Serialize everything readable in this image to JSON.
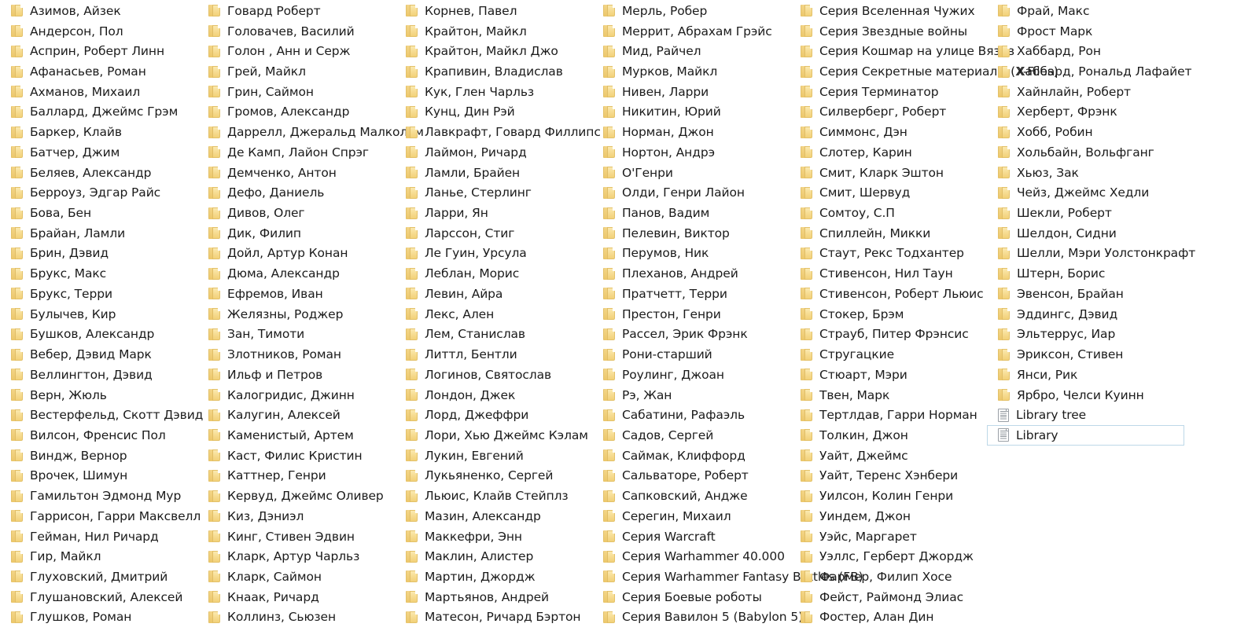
{
  "view": {
    "type": "file-explorer-list",
    "columns": 6,
    "rows_per_column": 31,
    "background_color": "#ffffff",
    "text_color": "#1b1b1b",
    "folder_icon_color": "#f4d57f",
    "document_icon_color": "#9aa0a6",
    "selection_border_color": "#bdd8e8"
  },
  "items": [
    {
      "label": "Азимов, Айзек",
      "icon": "folder-icon",
      "selected": false
    },
    {
      "label": "Андерсон, Пол",
      "icon": "folder-icon",
      "selected": false
    },
    {
      "label": "Асприн, Роберт Линн",
      "icon": "folder-icon",
      "selected": false
    },
    {
      "label": "Афанасьев, Роман",
      "icon": "folder-icon",
      "selected": false
    },
    {
      "label": "Ахманов, Михаил",
      "icon": "folder-icon",
      "selected": false
    },
    {
      "label": "Баллард, Джеймс Грэм",
      "icon": "folder-icon",
      "selected": false
    },
    {
      "label": "Баркер, Клайв",
      "icon": "folder-icon",
      "selected": false
    },
    {
      "label": "Батчер, Джим",
      "icon": "folder-icon",
      "selected": false
    },
    {
      "label": "Беляев, Александр",
      "icon": "folder-icon",
      "selected": false
    },
    {
      "label": "Берроуз, Эдгар Райс",
      "icon": "folder-icon",
      "selected": false
    },
    {
      "label": "Бова, Бен",
      "icon": "folder-icon",
      "selected": false
    },
    {
      "label": "Брайан, Ламли",
      "icon": "folder-icon",
      "selected": false
    },
    {
      "label": "Брин, Дэвид",
      "icon": "folder-icon",
      "selected": false
    },
    {
      "label": "Брукс, Макс",
      "icon": "folder-icon",
      "selected": false
    },
    {
      "label": "Брукс, Терри",
      "icon": "folder-icon",
      "selected": false
    },
    {
      "label": "Булычев, Кир",
      "icon": "folder-icon",
      "selected": false
    },
    {
      "label": "Бушков, Александр",
      "icon": "folder-icon",
      "selected": false
    },
    {
      "label": "Вебер, Дэвид Марк",
      "icon": "folder-icon",
      "selected": false
    },
    {
      "label": "Веллингтон, Дэвид",
      "icon": "folder-icon",
      "selected": false
    },
    {
      "label": "Верн, Жюль",
      "icon": "folder-icon",
      "selected": false
    },
    {
      "label": "Вестерфельд, Скотт Дэвид",
      "icon": "folder-icon",
      "selected": false
    },
    {
      "label": "Вилсон, Френсис Пол",
      "icon": "folder-icon",
      "selected": false
    },
    {
      "label": "Виндж, Вернор",
      "icon": "folder-icon",
      "selected": false
    },
    {
      "label": "Врочек, Шимун",
      "icon": "folder-icon",
      "selected": false
    },
    {
      "label": "Гамильтон Эдмонд Мур",
      "icon": "folder-icon",
      "selected": false
    },
    {
      "label": "Гаррисон, Гарри Максвелл",
      "icon": "folder-icon",
      "selected": false
    },
    {
      "label": "Гейман, Нил Ричард",
      "icon": "folder-icon",
      "selected": false
    },
    {
      "label": "Гир, Майкл",
      "icon": "folder-icon",
      "selected": false
    },
    {
      "label": "Глуховский, Дмитрий",
      "icon": "folder-icon",
      "selected": false
    },
    {
      "label": "Глушановский, Алексей",
      "icon": "folder-icon",
      "selected": false
    },
    {
      "label": "Глушков, Роман",
      "icon": "folder-icon",
      "selected": false
    },
    {
      "label": "Говард Роберт",
      "icon": "folder-icon",
      "selected": false
    },
    {
      "label": "Головачев, Василий",
      "icon": "folder-icon",
      "selected": false
    },
    {
      "label": "Голон , Анн и Серж",
      "icon": "folder-icon",
      "selected": false
    },
    {
      "label": "Грей, Майкл",
      "icon": "folder-icon",
      "selected": false
    },
    {
      "label": "Грин, Саймон",
      "icon": "folder-icon",
      "selected": false
    },
    {
      "label": "Громов, Александр",
      "icon": "folder-icon",
      "selected": false
    },
    {
      "label": "Даррелл, Джеральд Малкольм",
      "icon": "folder-icon",
      "selected": false
    },
    {
      "label": "Де Камп, Лайон Спрэг",
      "icon": "folder-icon",
      "selected": false
    },
    {
      "label": "Демченко, Антон",
      "icon": "folder-icon",
      "selected": false
    },
    {
      "label": "Дефо, Даниель",
      "icon": "folder-icon",
      "selected": false
    },
    {
      "label": "Дивов, Олег",
      "icon": "folder-icon",
      "selected": false
    },
    {
      "label": "Дик, Филип",
      "icon": "folder-icon",
      "selected": false
    },
    {
      "label": "Дойл, Артур Конан",
      "icon": "folder-icon",
      "selected": false
    },
    {
      "label": "Дюма, Александр",
      "icon": "folder-icon",
      "selected": false
    },
    {
      "label": "Ефремов, Иван",
      "icon": "folder-icon",
      "selected": false
    },
    {
      "label": "Желязны, Роджер",
      "icon": "folder-icon",
      "selected": false
    },
    {
      "label": "Зан, Тимоти",
      "icon": "folder-icon",
      "selected": false
    },
    {
      "label": "Злотников, Роман",
      "icon": "folder-icon",
      "selected": false
    },
    {
      "label": "Ильф и  Петров",
      "icon": "folder-icon",
      "selected": false
    },
    {
      "label": "Калогридис, Джинн",
      "icon": "folder-icon",
      "selected": false
    },
    {
      "label": "Калугин, Алексей",
      "icon": "folder-icon",
      "selected": false
    },
    {
      "label": "Каменистый, Артем",
      "icon": "folder-icon",
      "selected": false
    },
    {
      "label": "Каст, Филис Кристин",
      "icon": "folder-icon",
      "selected": false
    },
    {
      "label": "Каттнер, Генри",
      "icon": "folder-icon",
      "selected": false
    },
    {
      "label": "Кервуд, Джеймс Оливер",
      "icon": "folder-icon",
      "selected": false
    },
    {
      "label": "Киз, Дэниэл",
      "icon": "folder-icon",
      "selected": false
    },
    {
      "label": "Кинг, Стивен Эдвин",
      "icon": "folder-icon",
      "selected": false
    },
    {
      "label": "Кларк, Артур Чарльз",
      "icon": "folder-icon",
      "selected": false
    },
    {
      "label": "Кларк, Саймон",
      "icon": "folder-icon",
      "selected": false
    },
    {
      "label": "Кнаак, Ричард",
      "icon": "folder-icon",
      "selected": false
    },
    {
      "label": "Коллинз, Сьюзен",
      "icon": "folder-icon",
      "selected": false
    },
    {
      "label": "Корнев, Павел",
      "icon": "folder-icon",
      "selected": false
    },
    {
      "label": "Крайтон, Майкл",
      "icon": "folder-icon",
      "selected": false
    },
    {
      "label": "Крайтон, Майкл Джо",
      "icon": "folder-icon",
      "selected": false
    },
    {
      "label": "Крапивин, Владислав",
      "icon": "folder-icon",
      "selected": false
    },
    {
      "label": "Кук, Глен Чарльз",
      "icon": "folder-icon",
      "selected": false
    },
    {
      "label": "Кунц, Дин Рэй",
      "icon": "folder-icon",
      "selected": false
    },
    {
      "label": "Лавкрафт, Говард Филлипс",
      "icon": "folder-icon",
      "selected": false
    },
    {
      "label": "Лаймон, Ричард",
      "icon": "folder-icon",
      "selected": false
    },
    {
      "label": "Ламли, Брайен",
      "icon": "folder-icon",
      "selected": false
    },
    {
      "label": "Ланье, Стерлинг",
      "icon": "folder-icon",
      "selected": false
    },
    {
      "label": "Ларри, Ян",
      "icon": "folder-icon",
      "selected": false
    },
    {
      "label": "Ларссон, Стиг",
      "icon": "folder-icon",
      "selected": false
    },
    {
      "label": "Ле Гуин, Урсула",
      "icon": "folder-icon",
      "selected": false
    },
    {
      "label": "Леблан, Морис",
      "icon": "folder-icon",
      "selected": false
    },
    {
      "label": "Левин, Айра",
      "icon": "folder-icon",
      "selected": false
    },
    {
      "label": "Лекс, Ален",
      "icon": "folder-icon",
      "selected": false
    },
    {
      "label": "Лем, Станислав",
      "icon": "folder-icon",
      "selected": false
    },
    {
      "label": "Литтл, Бентли",
      "icon": "folder-icon",
      "selected": false
    },
    {
      "label": "Логинов, Святослав",
      "icon": "folder-icon",
      "selected": false
    },
    {
      "label": "Лондон, Джек",
      "icon": "folder-icon",
      "selected": false
    },
    {
      "label": "Лорд, Джеффри",
      "icon": "folder-icon",
      "selected": false
    },
    {
      "label": "Лори, Хью Джеймс Кэлам",
      "icon": "folder-icon",
      "selected": false
    },
    {
      "label": "Лукин, Евгений",
      "icon": "folder-icon",
      "selected": false
    },
    {
      "label": "Лукьяненко, Сергей",
      "icon": "folder-icon",
      "selected": false
    },
    {
      "label": "Льюис, Клайв Стейплз",
      "icon": "folder-icon",
      "selected": false
    },
    {
      "label": "Мазин, Александр",
      "icon": "folder-icon",
      "selected": false
    },
    {
      "label": "Маккефри, Энн",
      "icon": "folder-icon",
      "selected": false
    },
    {
      "label": "Маклин, Алистер",
      "icon": "folder-icon",
      "selected": false
    },
    {
      "label": "Мартин, Джордж",
      "icon": "folder-icon",
      "selected": false
    },
    {
      "label": "Мартьянов, Андрей",
      "icon": "folder-icon",
      "selected": false
    },
    {
      "label": "Матесон, Ричард Бэртон",
      "icon": "folder-icon",
      "selected": false
    },
    {
      "label": "Мерль, Робер",
      "icon": "folder-icon",
      "selected": false
    },
    {
      "label": "Меррит, Абрахам Грэйс",
      "icon": "folder-icon",
      "selected": false
    },
    {
      "label": "Мид, Райчел",
      "icon": "folder-icon",
      "selected": false
    },
    {
      "label": "Мурков, Майкл",
      "icon": "folder-icon",
      "selected": false
    },
    {
      "label": "Нивен, Ларри",
      "icon": "folder-icon",
      "selected": false
    },
    {
      "label": "Никитин, Юрий",
      "icon": "folder-icon",
      "selected": false
    },
    {
      "label": "Норман, Джон",
      "icon": "folder-icon",
      "selected": false
    },
    {
      "label": "Нортон, Андрэ",
      "icon": "folder-icon",
      "selected": false
    },
    {
      "label": "О'Генри",
      "icon": "folder-icon",
      "selected": false
    },
    {
      "label": "Олди, Генри Лайон",
      "icon": "folder-icon",
      "selected": false
    },
    {
      "label": "Панов, Вадим",
      "icon": "folder-icon",
      "selected": false
    },
    {
      "label": "Пелевин, Виктор",
      "icon": "folder-icon",
      "selected": false
    },
    {
      "label": "Перумов, Ник",
      "icon": "folder-icon",
      "selected": false
    },
    {
      "label": "Плеханов, Андрей",
      "icon": "folder-icon",
      "selected": false
    },
    {
      "label": "Пратчетт, Терри",
      "icon": "folder-icon",
      "selected": false
    },
    {
      "label": "Престон, Генри",
      "icon": "folder-icon",
      "selected": false
    },
    {
      "label": "Рассел, Эрик Фрэнк",
      "icon": "folder-icon",
      "selected": false
    },
    {
      "label": "Рони-старший",
      "icon": "folder-icon",
      "selected": false
    },
    {
      "label": "Роулинг, Джоан",
      "icon": "folder-icon",
      "selected": false
    },
    {
      "label": "Рэ, Жан",
      "icon": "folder-icon",
      "selected": false
    },
    {
      "label": "Сабатини, Рафаэль",
      "icon": "folder-icon",
      "selected": false
    },
    {
      "label": "Садов, Сергей",
      "icon": "folder-icon",
      "selected": false
    },
    {
      "label": "Саймак, Клиффорд",
      "icon": "folder-icon",
      "selected": false
    },
    {
      "label": "Сальваторе, Роберт",
      "icon": "folder-icon",
      "selected": false
    },
    {
      "label": "Сапковский, Андже",
      "icon": "folder-icon",
      "selected": false
    },
    {
      "label": "Серегин, Михаил",
      "icon": "folder-icon",
      "selected": false
    },
    {
      "label": "Серия Warcraft",
      "icon": "folder-icon",
      "selected": false
    },
    {
      "label": "Серия Warhammer 40.000",
      "icon": "folder-icon",
      "selected": false
    },
    {
      "label": "Серия Warhammer Fantasy Battles (FB)",
      "icon": "folder-icon",
      "selected": false
    },
    {
      "label": "Серия Боевые роботы",
      "icon": "folder-icon",
      "selected": false
    },
    {
      "label": "Серия Вавилон 5 (Babylon 5)",
      "icon": "folder-icon",
      "selected": false
    },
    {
      "label": "Серия Вселенная Чужих",
      "icon": "folder-icon",
      "selected": false
    },
    {
      "label": "Серия Звездные войны",
      "icon": "folder-icon",
      "selected": false
    },
    {
      "label": "Серия Кошмар на улице Вязов",
      "icon": "folder-icon",
      "selected": false
    },
    {
      "label": "Серия Секретные материалы (X-Files)",
      "icon": "folder-icon",
      "selected": false
    },
    {
      "label": "Серия Терминатор",
      "icon": "folder-icon",
      "selected": false
    },
    {
      "label": "Силверберг, Роберт",
      "icon": "folder-icon",
      "selected": false
    },
    {
      "label": "Симмонс, Дэн",
      "icon": "folder-icon",
      "selected": false
    },
    {
      "label": "Слотер, Карин",
      "icon": "folder-icon",
      "selected": false
    },
    {
      "label": "Смит, Кларк Эштон",
      "icon": "folder-icon",
      "selected": false
    },
    {
      "label": "Смит, Шервуд",
      "icon": "folder-icon",
      "selected": false
    },
    {
      "label": "Сомтоу, С.П",
      "icon": "folder-icon",
      "selected": false
    },
    {
      "label": "Спиллейн, Микки",
      "icon": "folder-icon",
      "selected": false
    },
    {
      "label": "Стаут, Рекс Тодхантер",
      "icon": "folder-icon",
      "selected": false
    },
    {
      "label": "Стивенсон, Нил Таун",
      "icon": "folder-icon",
      "selected": false
    },
    {
      "label": "Стивенсон, Роберт Льюис",
      "icon": "folder-icon",
      "selected": false
    },
    {
      "label": "Стокер, Брэм",
      "icon": "folder-icon",
      "selected": false
    },
    {
      "label": "Страуб, Питер Фрэнсис",
      "icon": "folder-icon",
      "selected": false
    },
    {
      "label": "Стругацкие",
      "icon": "folder-icon",
      "selected": false
    },
    {
      "label": "Стюарт, Мэри",
      "icon": "folder-icon",
      "selected": false
    },
    {
      "label": "Твен, Марк",
      "icon": "folder-icon",
      "selected": false
    },
    {
      "label": "Тертлдав, Гарри Норман",
      "icon": "folder-icon",
      "selected": false
    },
    {
      "label": "Толкин, Джон",
      "icon": "folder-icon",
      "selected": false
    },
    {
      "label": "Уайт, Джеймс",
      "icon": "folder-icon",
      "selected": false
    },
    {
      "label": "Уайт, Теренс Хэнбери",
      "icon": "folder-icon",
      "selected": false
    },
    {
      "label": "Уилсон, Колин Генри",
      "icon": "folder-icon",
      "selected": false
    },
    {
      "label": "Уиндем, Джон",
      "icon": "folder-icon",
      "selected": false
    },
    {
      "label": "Уэйс, Маргарет",
      "icon": "folder-icon",
      "selected": false
    },
    {
      "label": "Уэллс, Герберт Джордж",
      "icon": "folder-icon",
      "selected": false
    },
    {
      "label": "Фармер, Филип Хосе",
      "icon": "folder-icon",
      "selected": false
    },
    {
      "label": "Фейст, Раймонд Элиас",
      "icon": "folder-icon",
      "selected": false
    },
    {
      "label": "Фостер, Алан Дин",
      "icon": "folder-icon",
      "selected": false
    },
    {
      "label": "Фрай, Макс",
      "icon": "folder-icon",
      "selected": false
    },
    {
      "label": "Фрост Марк",
      "icon": "folder-icon",
      "selected": false
    },
    {
      "label": "Хаббард, Рон",
      "icon": "folder-icon",
      "selected": false
    },
    {
      "label": "Хаббард, Рональд Лафайет",
      "icon": "folder-icon",
      "selected": false
    },
    {
      "label": "Хайнлайн, Роберт",
      "icon": "folder-icon",
      "selected": false
    },
    {
      "label": "Херберт, Фрэнк",
      "icon": "folder-icon",
      "selected": false
    },
    {
      "label": "Хобб, Робин",
      "icon": "folder-icon",
      "selected": false
    },
    {
      "label": "Хольбайн, Вольфганг",
      "icon": "folder-icon",
      "selected": false
    },
    {
      "label": "Хьюз, Зак",
      "icon": "folder-icon",
      "selected": false
    },
    {
      "label": "Чейз, Джеймс Хедли",
      "icon": "folder-icon",
      "selected": false
    },
    {
      "label": "Шекли, Роберт",
      "icon": "folder-icon",
      "selected": false
    },
    {
      "label": "Шелдон, Сидни",
      "icon": "folder-icon",
      "selected": false
    },
    {
      "label": "Шелли, Мэри Уолстонкрафт",
      "icon": "folder-icon",
      "selected": false
    },
    {
      "label": "Штерн, Борис",
      "icon": "folder-icon",
      "selected": false
    },
    {
      "label": "Эвенсон, Брайан",
      "icon": "folder-icon",
      "selected": false
    },
    {
      "label": "Эддингс, Дэвид",
      "icon": "folder-icon",
      "selected": false
    },
    {
      "label": "Эльтеррус, Иар",
      "icon": "folder-icon",
      "selected": false
    },
    {
      "label": "Эриксон, Стивен",
      "icon": "folder-icon",
      "selected": false
    },
    {
      "label": "Янси, Рик",
      "icon": "folder-icon",
      "selected": false
    },
    {
      "label": "Ярбро, Челси Куинн",
      "icon": "folder-icon",
      "selected": false
    },
    {
      "label": "Library tree",
      "icon": "document-icon",
      "selected": false
    },
    {
      "label": "Library",
      "icon": "document-icon",
      "selected": true
    }
  ]
}
